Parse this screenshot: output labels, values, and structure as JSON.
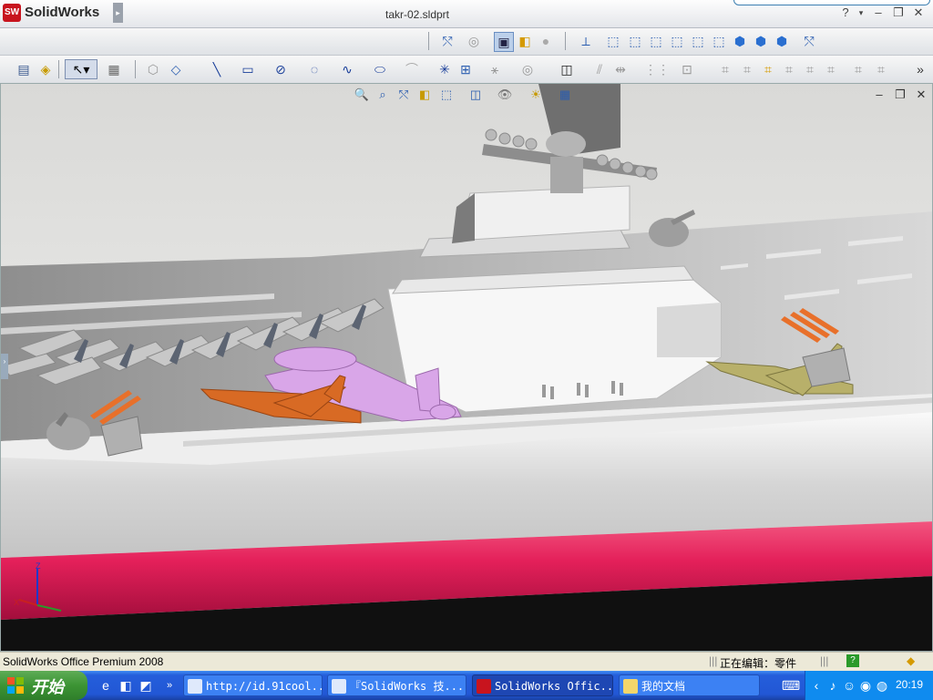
{
  "app": {
    "brand": "SolidWorks",
    "logo_text": "SW",
    "document_title": "takr-02.sldprt"
  },
  "window_controls": {
    "help": "?",
    "minimize": "–",
    "restore": "❐",
    "close": "✕"
  },
  "viewport_controls": {
    "minimize": "–",
    "restore": "❐",
    "close": "✕"
  },
  "status": {
    "product": "SolidWorks Office Premium 2008",
    "editing": "正在编辑：零件"
  },
  "taskbar": {
    "start_label": "开始",
    "tasks": [
      {
        "label": "http://id.91cool...",
        "icon": "ie-icon"
      },
      {
        "label": "『SolidWorks 技...",
        "icon": "ie-icon"
      },
      {
        "label": "SolidWorks Offic...",
        "icon": "solidworks-icon"
      },
      {
        "label": "我的文档",
        "icon": "folder-icon"
      }
    ],
    "clock": "20:19"
  },
  "colors": {
    "hull_red": "#e4205a",
    "deck_gray": "#cfcfcf",
    "taskbar_blue": "#245edb",
    "tray_blue": "#0f8bef"
  }
}
